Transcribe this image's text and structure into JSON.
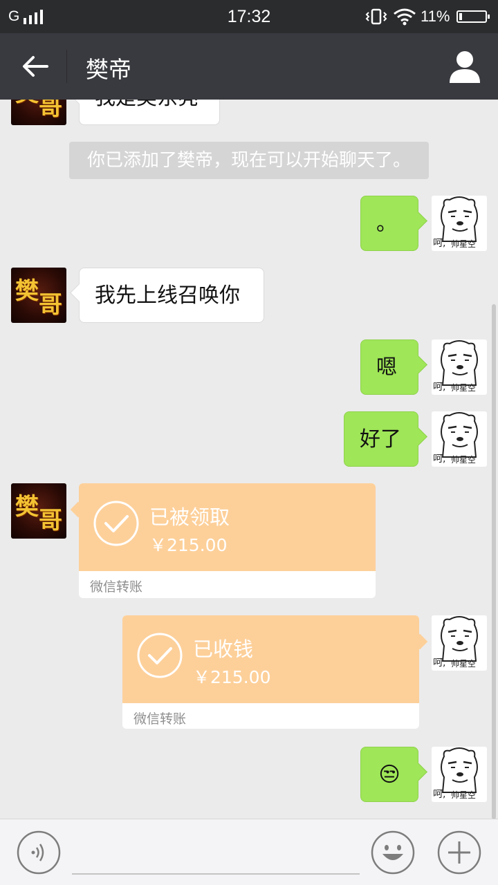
{
  "status": {
    "network": "G",
    "time": "17:32",
    "battery": "11%"
  },
  "header": {
    "title": "樊帝"
  },
  "friend_avatar": {
    "line1": "樊",
    "line2": "哥"
  },
  "my_avatar": {
    "caption_a": "呵,",
    "caption_b": "帅星空"
  },
  "messages": {
    "m0": "我是樊东亮",
    "sys": "你已添加了樊帝，现在可以开始聊天了。",
    "m1": "。",
    "m2": "我先上线召唤你",
    "m3": "嗯",
    "m4": "好了",
    "t1": {
      "title": "已被领取",
      "amount": "￥215.00",
      "footer": "微信转账"
    },
    "t2": {
      "title": "已收钱",
      "amount": "￥215.00",
      "footer": "微信转账"
    },
    "m5": "😒"
  },
  "colors": {
    "outgoing_bubble": "#9fe658",
    "transfer_card": "#fdd09a",
    "title_bar": "#393a3f"
  },
  "icons": [
    "back-arrow-icon",
    "profile-icon",
    "voice-icon",
    "emoji-icon",
    "plus-icon",
    "check-circle-icon"
  ]
}
